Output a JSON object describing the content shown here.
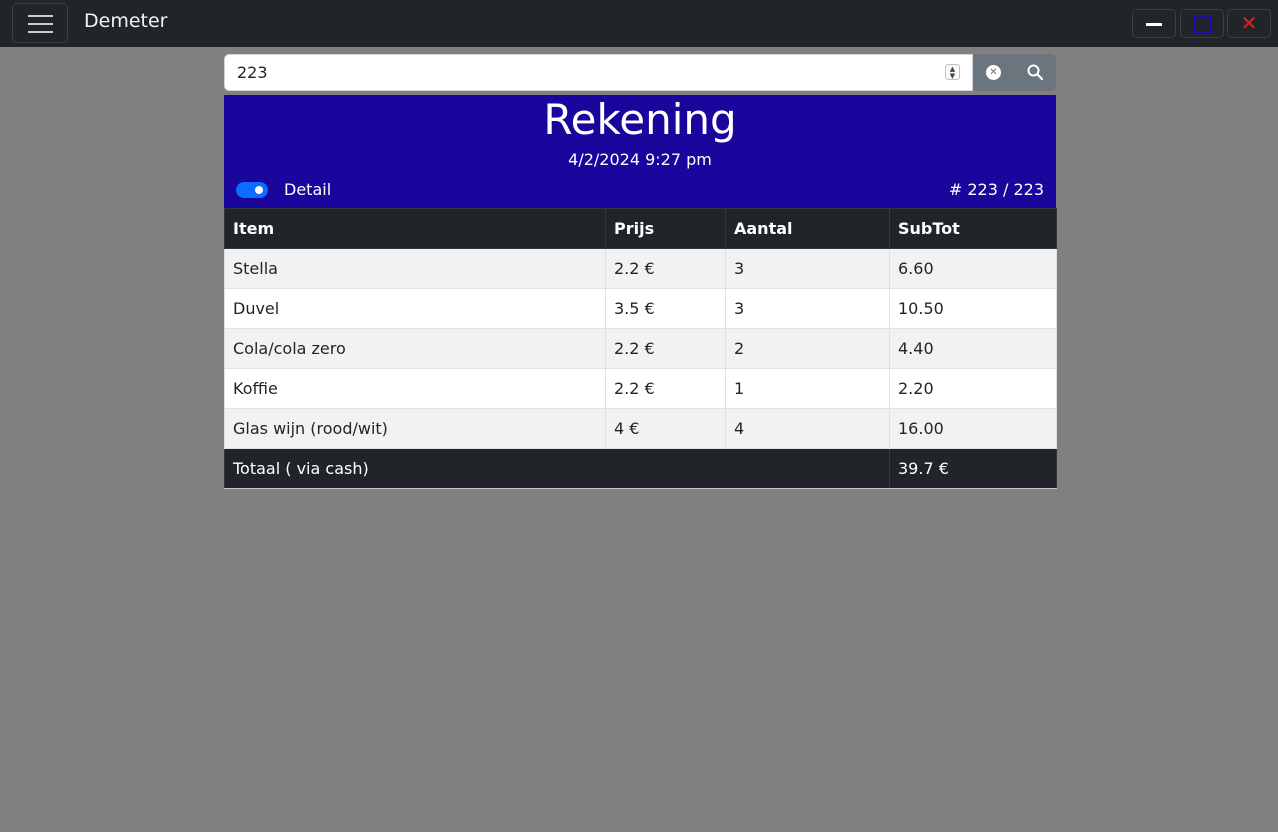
{
  "app": {
    "title": "Demeter"
  },
  "window_controls": {
    "minimize": "–",
    "maximize": "",
    "close": "✕"
  },
  "search": {
    "value": "223"
  },
  "receipt": {
    "title": "Rekening",
    "datetime": "4/2/2024 9:27 pm",
    "detail_label": "Detail",
    "detail_enabled": true,
    "number": "# 223 / 223"
  },
  "table": {
    "headers": [
      "Item",
      "Prijs",
      "Aantal",
      "SubTot"
    ],
    "rows": [
      [
        "Stella",
        "2.2 €",
        "3",
        "6.60"
      ],
      [
        "Duvel",
        "3.5 €",
        "3",
        "10.50"
      ],
      [
        "Cola/cola zero",
        "2.2 €",
        "2",
        "4.40"
      ],
      [
        "Koffie",
        "2.2 €",
        "1",
        "2.20"
      ],
      [
        "Glas wijn (rood/wit)",
        "4 €",
        "4",
        "16.00"
      ]
    ],
    "total_label": "Totaal ( via cash)",
    "total_value": "39.7 €"
  },
  "colors": {
    "topbar": "#212529",
    "header_bg": "#1a069d",
    "toggle": "#0d6efd",
    "close_icon": "#e02020",
    "page_bg": "#808080"
  }
}
